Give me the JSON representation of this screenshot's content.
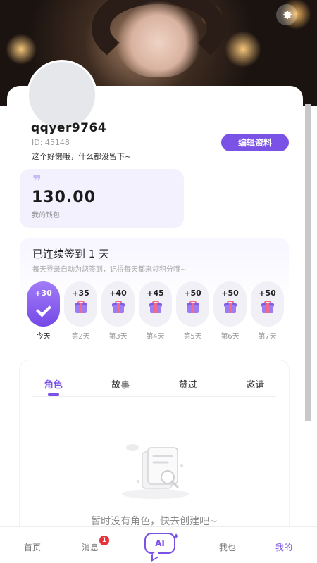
{
  "profile": {
    "username": "qqyer9764",
    "user_id": "ID: 45148",
    "bio": "这个好懒哦，什么都没留下~",
    "edit_label": "编辑资料"
  },
  "wallet": {
    "amount": "130.00",
    "label": "我的钱包"
  },
  "checkin": {
    "title": "已连续签到 1 天",
    "subtitle": "每天登录自动为您签到，记得每天都来领积分哦~",
    "days": [
      {
        "reward": "+30",
        "label": "今天",
        "checked": true
      },
      {
        "reward": "+35",
        "label": "第2天",
        "checked": false
      },
      {
        "reward": "+40",
        "label": "第3天",
        "checked": false
      },
      {
        "reward": "+45",
        "label": "第4天",
        "checked": false
      },
      {
        "reward": "+50",
        "label": "第5天",
        "checked": false
      },
      {
        "reward": "+50",
        "label": "第6天",
        "checked": false
      },
      {
        "reward": "+50",
        "label": "第7天",
        "checked": false
      }
    ]
  },
  "tabs": [
    {
      "label": "角色",
      "active": true
    },
    {
      "label": "故事",
      "active": false
    },
    {
      "label": "赞过",
      "active": false
    },
    {
      "label": "邀请",
      "active": false
    }
  ],
  "empty_state": {
    "text": "暂时没有角色，快去创建吧~"
  },
  "bottom_nav": {
    "home": "首页",
    "messages": "消息",
    "message_badge": "1",
    "ai": "AI",
    "nav4": "我也",
    "profile": "我的"
  },
  "colors": {
    "accent": "#7b52e6",
    "badge": "#e8313b"
  },
  "icons": {
    "settings": "gear-icon",
    "gift": "gift-icon",
    "check": "check-icon",
    "quote": "quote-icon"
  }
}
